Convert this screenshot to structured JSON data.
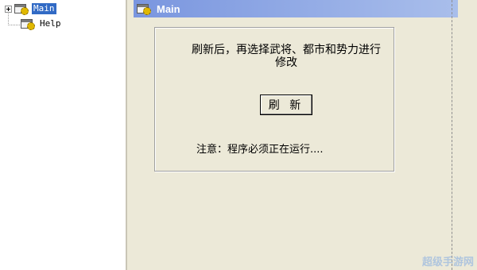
{
  "tree": {
    "items": [
      {
        "label": "Main",
        "icon": "gear-window-icon",
        "selected": true
      },
      {
        "label": "Help",
        "icon": "gear-window-icon",
        "selected": false
      }
    ]
  },
  "pane": {
    "title": "Main",
    "instruction": "刷新后，再选择武将、都市和势力进行修改",
    "refresh_label": "刷 新",
    "note": "注意：程序必须正在运行...."
  },
  "watermark": "超级手游网",
  "colors": {
    "selection": "#316AC5",
    "title_bar_start": "#7A96DF",
    "title_bar_end": "#A9BEEB",
    "panel_bg": "#ECE9D8"
  }
}
